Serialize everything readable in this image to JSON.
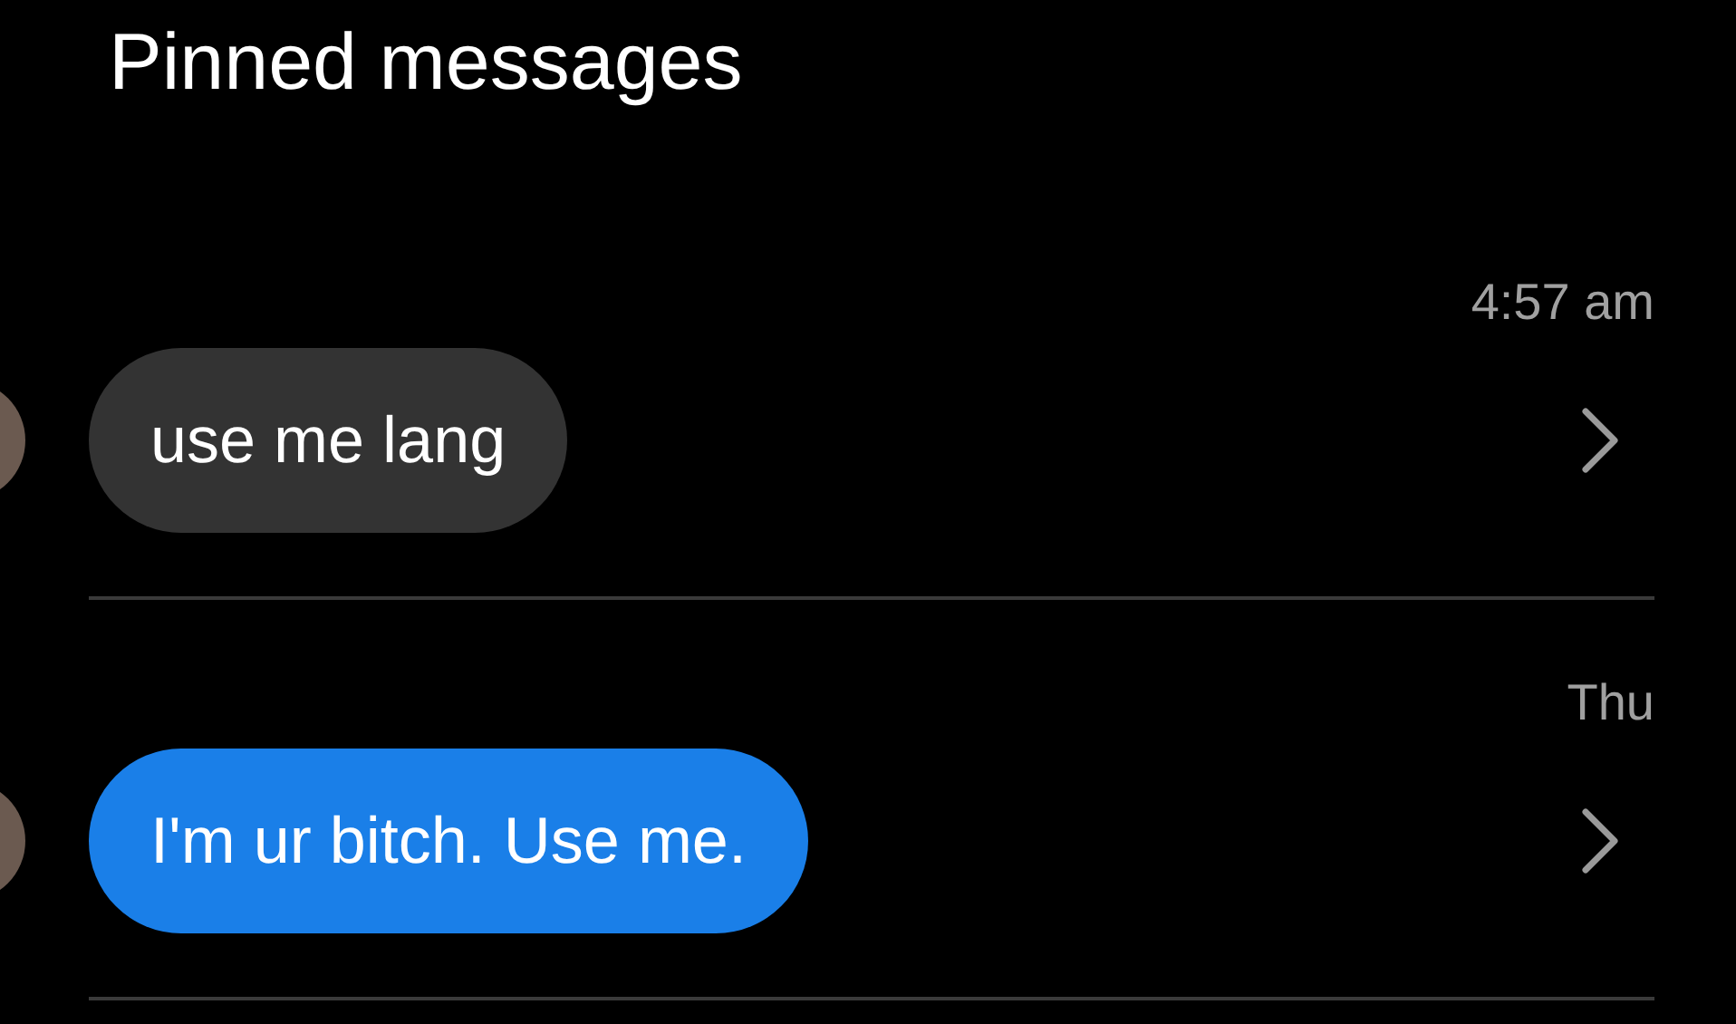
{
  "header": {
    "title": "Pinned messages"
  },
  "messages": [
    {
      "time": "4:57 am",
      "text": "use me lang",
      "kind": "received"
    },
    {
      "time": "Thu",
      "text": "I'm ur bitch. Use me.",
      "kind": "sent"
    }
  ]
}
